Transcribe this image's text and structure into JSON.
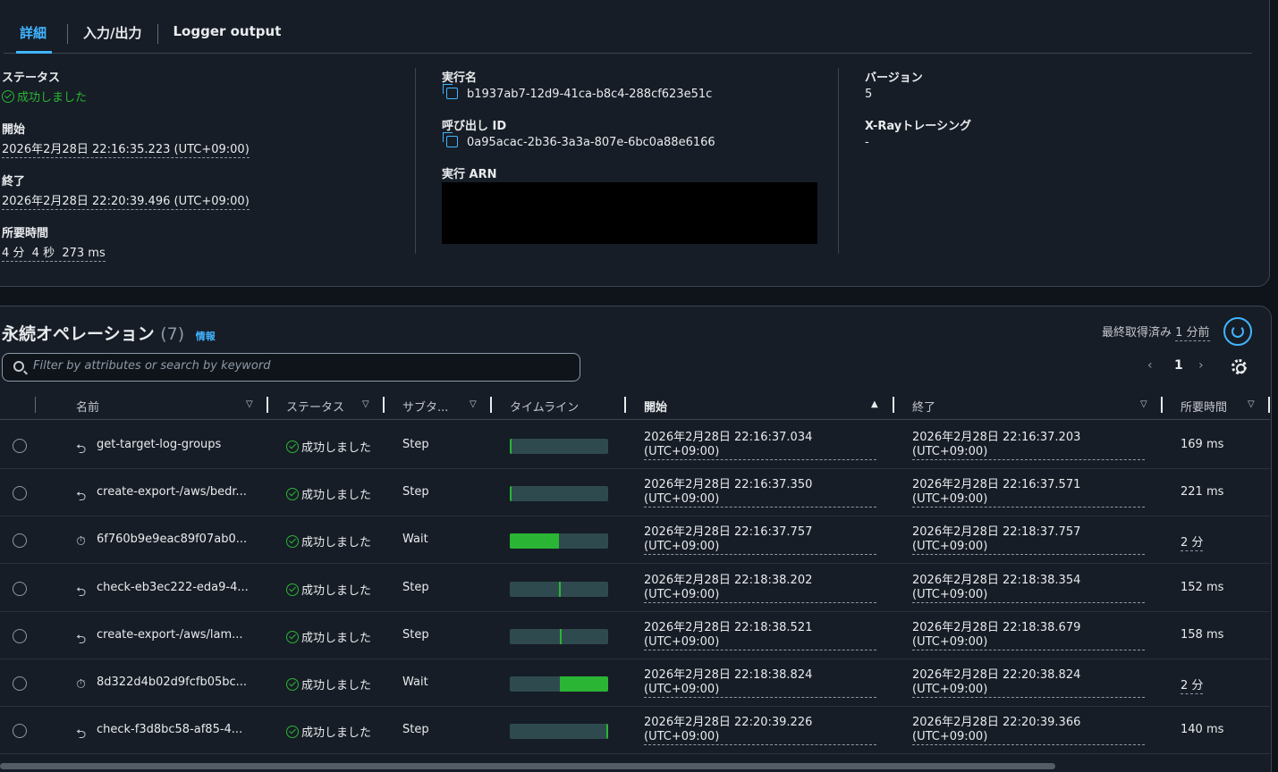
{
  "tabs": [
    {
      "label": "詳細",
      "active": true
    },
    {
      "label": "入力/出力",
      "active": false
    },
    {
      "label": "Logger output",
      "active": false
    }
  ],
  "details": {
    "status_label": "ステータス",
    "status_value": "成功しました",
    "start_label": "開始",
    "start_value": "2026年2月28日 22:16:35.223 (UTC+09:00)",
    "end_label": "終了",
    "end_value": "2026年2月28日 22:20:39.496 (UTC+09:00)",
    "duration_label": "所要時間",
    "duration_value": "4 分  4 秒  273 ms",
    "exec_name_label": "実行名",
    "exec_name_value": "b1937ab7-12d9-41ca-b8c4-288cf623e51c",
    "invocation_label": "呼び出し ID",
    "invocation_value": "0a95acac-2b36-3a3a-807e-6bc0a88e6166",
    "arn_label": "実行 ARN",
    "version_label": "バージョン",
    "version_value": "5",
    "xray_label": "X-Rayトレーシング",
    "xray_value": "-"
  },
  "operations": {
    "title": "永続オペレーション",
    "count": "(7)",
    "info": "情報",
    "refreshed": "最終取得済み",
    "refreshed_ago": "1 分前",
    "search_placeholder": "Filter by attributes or search by keyword",
    "page": "1",
    "columns": {
      "name": "名前",
      "status": "ステータス",
      "subtype": "サブタ...",
      "timeline": "タイムライン",
      "start": "開始",
      "end": "終了",
      "duration": "所要時間"
    },
    "rows": [
      {
        "icon": "step",
        "name": "get-target-log-groups",
        "status": "成功しました",
        "subtype": "Step",
        "bar_start": 0.0,
        "bar_len": 0.02,
        "start": "2026年2月28日 22:16:37.034",
        "start_tz": "(UTC+09:00)",
        "end": "2026年2月28日 22:16:37.203",
        "end_tz": "(UTC+09:00)",
        "duration": "169 ms"
      },
      {
        "icon": "step",
        "name": "create-export-/aws/bedr...",
        "status": "成功しました",
        "subtype": "Step",
        "bar_start": 0.0,
        "bar_len": 0.02,
        "start": "2026年2月28日 22:16:37.350",
        "start_tz": "(UTC+09:00)",
        "end": "2026年2月28日 22:16:37.571",
        "end_tz": "(UTC+09:00)",
        "duration": "221 ms"
      },
      {
        "icon": "wait",
        "name": "6f760b9e9eac89f07ab0...",
        "status": "成功しました",
        "subtype": "Wait",
        "bar_start": 0.0,
        "bar_len": 0.5,
        "start": "2026年2月28日 22:16:37.757",
        "start_tz": "(UTC+09:00)",
        "end": "2026年2月28日 22:18:37.757",
        "end_tz": "(UTC+09:00)",
        "duration": "2 分"
      },
      {
        "icon": "step",
        "name": "check-eb3ec222-eda9-4...",
        "status": "成功しました",
        "subtype": "Step",
        "bar_start": 0.5,
        "bar_len": 0.02,
        "start": "2026年2月28日 22:18:38.202",
        "start_tz": "(UTC+09:00)",
        "end": "2026年2月28日 22:18:38.354",
        "end_tz": "(UTC+09:00)",
        "duration": "152 ms"
      },
      {
        "icon": "step",
        "name": "create-export-/aws/lam...",
        "status": "成功しました",
        "subtype": "Step",
        "bar_start": 0.51,
        "bar_len": 0.02,
        "start": "2026年2月28日 22:18:38.521",
        "start_tz": "(UTC+09:00)",
        "end": "2026年2月28日 22:18:38.679",
        "end_tz": "(UTC+09:00)",
        "duration": "158 ms"
      },
      {
        "icon": "wait",
        "name": "8d322d4b02d9fcfb05bc...",
        "status": "成功しました",
        "subtype": "Wait",
        "bar_start": 0.51,
        "bar_len": 0.49,
        "start": "2026年2月28日 22:18:38.824",
        "start_tz": "(UTC+09:00)",
        "end": "2026年2月28日 22:20:38.824",
        "end_tz": "(UTC+09:00)",
        "duration": "2 分"
      },
      {
        "icon": "step",
        "name": "check-f3d8bc58-af85-4...",
        "status": "成功しました",
        "subtype": "Step",
        "bar_start": 0.98,
        "bar_len": 0.02,
        "start": "2026年2月28日 22:20:39.226",
        "start_tz": "(UTC+09:00)",
        "end": "2026年2月28日 22:20:39.366",
        "end_tz": "(UTC+09:00)",
        "duration": "140 ms"
      }
    ]
  },
  "colors": {
    "accent": "#42b4ff",
    "success": "#2bb534",
    "bar_track": "#2f4a4f"
  }
}
